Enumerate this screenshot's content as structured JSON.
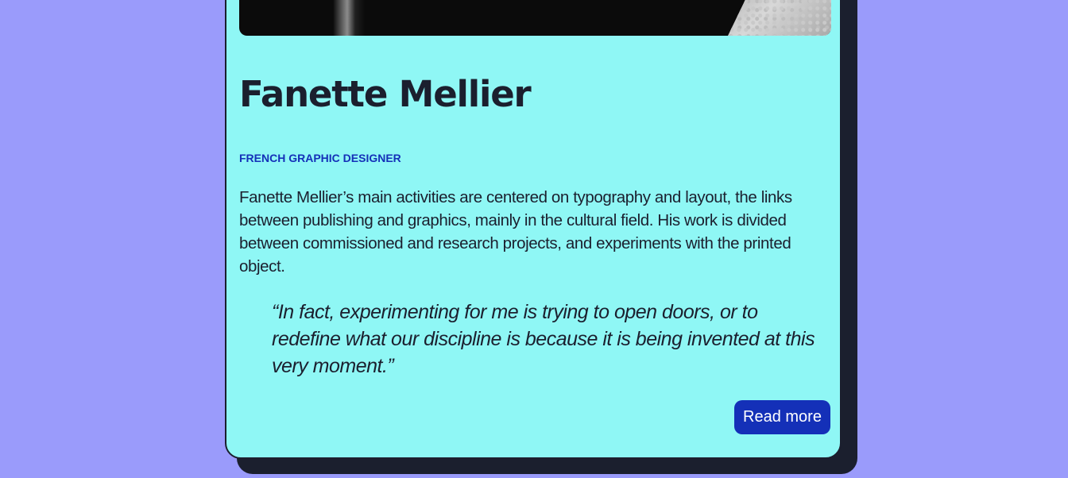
{
  "profile": {
    "name": "Fanette Mellier",
    "role": "French graphic designer",
    "bio": "Fanette Mellier’s main activities are centered on typography and layout, the links between publishing and graphics, mainly in the cultural field. His work is divided between commissioned and research projects, and experiments with the printed object.",
    "quote": "“In fact, experimenting for me is trying to open doors, or to redefine what our discipline is because it is being invented at this very moment.”",
    "read_more_label": "Read more"
  },
  "colors": {
    "page_background": "#9a9bfb",
    "card_background": "#8ff7f5",
    "card_shadow": "#1b1f2e",
    "text": "#1b1f2e",
    "accent": "#1430b8"
  }
}
